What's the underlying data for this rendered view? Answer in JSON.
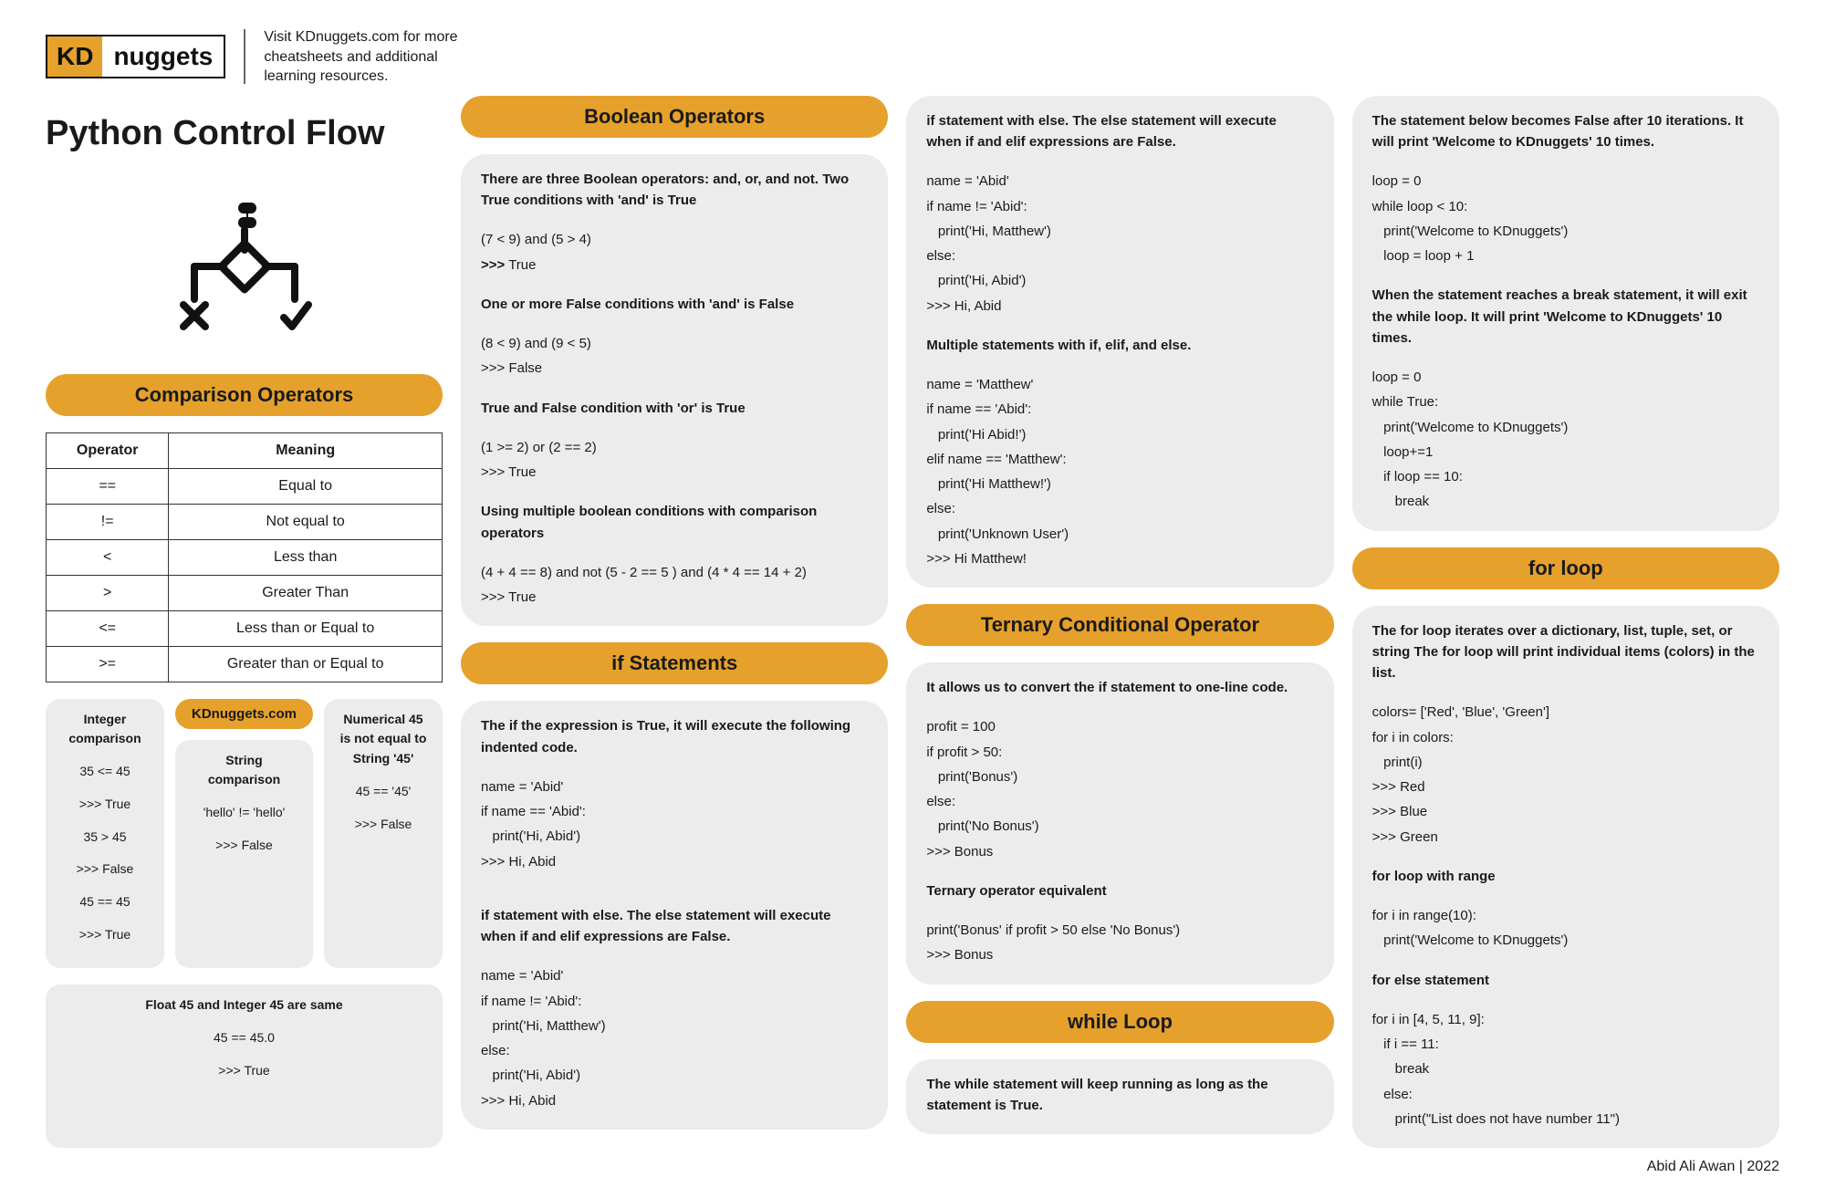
{
  "header": {
    "logo_prefix": "KD",
    "logo_suffix": "nuggets",
    "tagline": "Visit KDnuggets.com for more cheatsheets and additional learning resources."
  },
  "page_title": "Python Control Flow",
  "comparison": {
    "title": "Comparison Operators",
    "table": {
      "headers": [
        "Operator",
        "Meaning"
      ],
      "rows": [
        [
          "==",
          "Equal to"
        ],
        [
          "!=",
          "Not equal to"
        ],
        [
          "<",
          "Less than"
        ],
        [
          ">",
          "Greater Than"
        ],
        [
          "<=",
          "Less than or Equal to"
        ],
        [
          ">=",
          "Greater than or Equal to"
        ]
      ]
    },
    "mini_link": "KDnuggets.com",
    "mini": {
      "integer": {
        "title": "Integer comparison",
        "lines": [
          "35 <= 45",
          ">>> True",
          "35 > 45",
          ">>> False",
          "45 == 45",
          ">>> True"
        ]
      },
      "string_cmp": {
        "title": "String comparison",
        "lines": [
          "'hello' != 'hello'",
          ">>> False"
        ]
      },
      "numeric45": {
        "title": "Numerical 45 is not equal to String '45'",
        "lines": [
          "45 == '45'",
          ">>> False"
        ]
      },
      "float_int": {
        "title": "Float 45 and Integer 45 are same",
        "lines": [
          "45 == 45.0",
          ">>> True"
        ]
      }
    }
  },
  "boolean": {
    "title": "Boolean Operators",
    "intro1": "There are three Boolean operators: and, or, and not. Two True conditions with 'and' is True",
    "ex1a": "(7 < 9) and (5 > 4)",
    "ex1b": ">>> True",
    "intro2": "One or more False conditions with 'and' is False",
    "ex2a": "(8 < 9) and (9 < 5)",
    "ex2b": ">>> False",
    "intro3": "True and False condition with 'or' is True",
    "ex3a": "(1 >= 2) or (2 == 2)",
    "ex3b": ">>> True",
    "intro4": "Using multiple boolean conditions with comparison operators",
    "ex4a": "(4 + 4 == 8) and not (5 - 2 == 5 ) and (4 * 4 == 14 + 2)",
    "ex4b": ">>> True"
  },
  "if_stmt": {
    "title": "if Statements",
    "intro1": "The if the expression is True, it will execute the following indented code.",
    "code1": [
      "name = 'Abid'",
      "if name == 'Abid':",
      "   print('Hi, Abid')",
      ">>> Hi, Abid"
    ],
    "intro2": "if statement with else. The else statement will execute when if and elif expressions are False.",
    "code2": [
      "name = 'Abid'",
      "if name != 'Abid':",
      "   print('Hi, Matthew')",
      "else:",
      "   print('Hi, Abid')",
      ">>> Hi, Abid"
    ]
  },
  "col3_top": {
    "intro1": "if statement with else. The else statement will execute when if and elif expressions are False.",
    "code1": [
      "name = 'Abid'",
      "if name != 'Abid':",
      "   print('Hi, Matthew')",
      "else:",
      "   print('Hi, Abid')",
      ">>> Hi, Abid"
    ],
    "intro2": "Multiple statements with if, elif, and else.",
    "code2": [
      "name = 'Matthew'",
      "if name == 'Abid':",
      "   print('Hi Abid!')",
      "elif name == 'Matthew':",
      "   print('Hi Matthew!')",
      "else:",
      "   print('Unknown User')",
      ">>> Hi Matthew!"
    ]
  },
  "ternary": {
    "title": "Ternary Conditional Operator",
    "intro1": "It allows us to convert the if statement to one-line code.",
    "code1": [
      "profit = 100",
      "if profit > 50:",
      "   print('Bonus')",
      "else:",
      "   print('No Bonus')",
      ">>> Bonus"
    ],
    "intro2": "Ternary operator equivalent",
    "code2": [
      "print('Bonus' if profit > 50 else 'No Bonus')",
      ">>> Bonus"
    ]
  },
  "while_loop": {
    "title": "while Loop",
    "intro1": "The while statement will keep running as long as the statement is True."
  },
  "while_cont": {
    "intro1": "The statement below becomes False after 10 iterations. It will print 'Welcome to KDnuggets' 10 times.",
    "code1": [
      "loop = 0",
      "while loop < 10:",
      "   print('Welcome to KDnuggets')",
      "   loop = loop + 1"
    ],
    "intro2": "When the statement reaches a break statement, it will exit the while loop. It will print 'Welcome to KDnuggets' 10 times.",
    "code2": [
      "loop = 0",
      "while True:",
      "   print('Welcome to KDnuggets')",
      "   loop+=1",
      "   if loop == 10:",
      "      break"
    ]
  },
  "for_loop": {
    "title": "for loop",
    "intro1": "The for loop iterates over a dictionary, list, tuple, set, or string The for loop will print individual items (colors) in the list.",
    "code1": [
      "colors= ['Red', 'Blue', 'Green']",
      "for i in colors:",
      "   print(i)",
      ">>> Red",
      ">>> Blue",
      ">>> Green"
    ],
    "intro2": "for loop with range",
    "code2": [
      "for i in range(10):",
      "   print('Welcome to KDnuggets')"
    ],
    "intro3": "for else statement",
    "code3": [
      "for i in [4, 5, 11, 9]:",
      "   if i == 11:",
      "      break",
      "   else:",
      "      print(\"List does not have number 11\")"
    ]
  },
  "footer": "Abid Ali Awan | 2022"
}
